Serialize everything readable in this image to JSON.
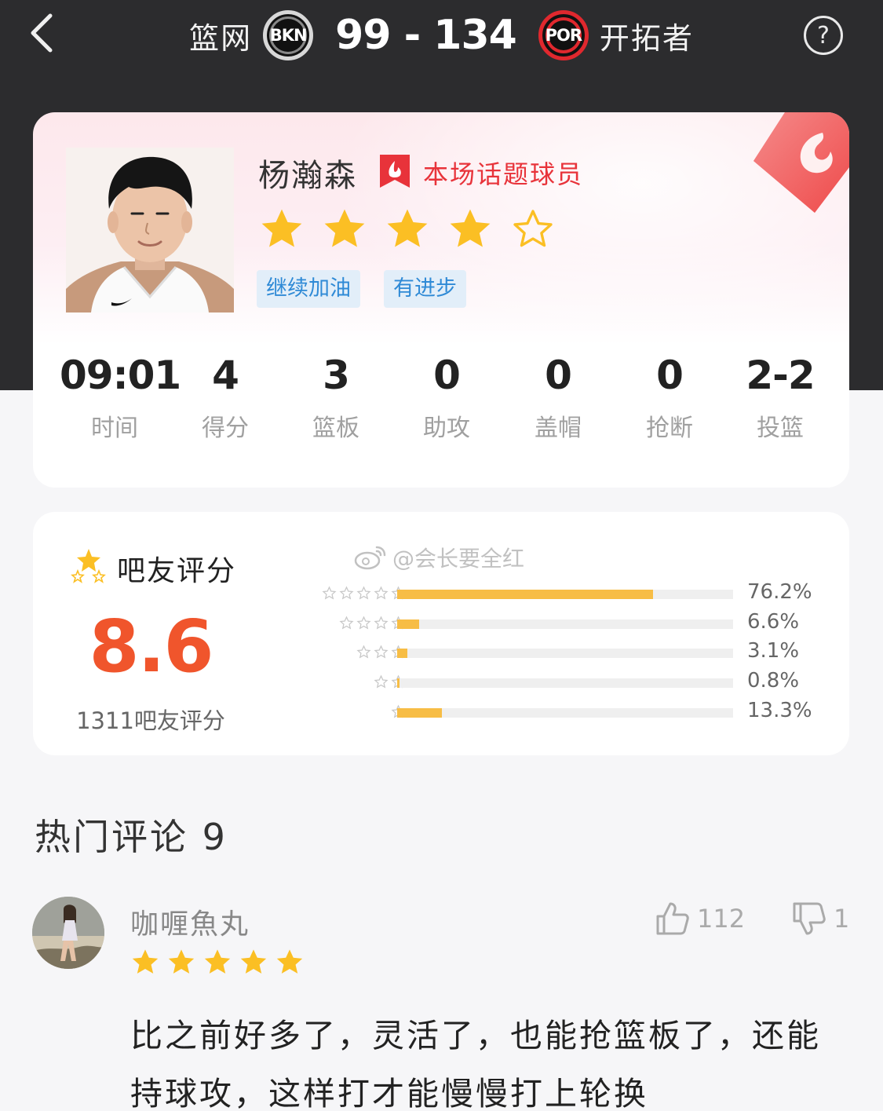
{
  "header": {
    "home_team": "篮网",
    "home_abbr": "BKN",
    "score": "99 - 134",
    "away_abbr": "POR",
    "away_team": "开拓者",
    "help_label": "?"
  },
  "player": {
    "name": "杨瀚森",
    "topic_label": "本场话题球员",
    "stars": 4,
    "max_stars": 5,
    "tags": [
      "继续加油",
      "有进步"
    ]
  },
  "stats": [
    {
      "value": "09:01",
      "label": "时间"
    },
    {
      "value": "4",
      "label": "得分"
    },
    {
      "value": "3",
      "label": "篮板"
    },
    {
      "value": "0",
      "label": "助攻"
    },
    {
      "value": "0",
      "label": "盖帽"
    },
    {
      "value": "0",
      "label": "抢断"
    },
    {
      "value": "2-2",
      "label": "投篮"
    }
  ],
  "rating": {
    "title": "吧友评分",
    "score": "8.6",
    "count_label": "1311吧友评分",
    "distribution": [
      {
        "stars": 5,
        "percent": 76.2,
        "label": "76.2%"
      },
      {
        "stars": 4,
        "percent": 6.6,
        "label": "6.6%"
      },
      {
        "stars": 3,
        "percent": 3.1,
        "label": "3.1%"
      },
      {
        "stars": 2,
        "percent": 0.8,
        "label": "0.8%"
      },
      {
        "stars": 1,
        "percent": 13.3,
        "label": "13.3%"
      }
    ]
  },
  "watermark": "@会长要全红",
  "comments_section": {
    "title": "热门评论 9"
  },
  "comment": {
    "author": "咖喱魚丸",
    "stars": 5,
    "likes": "112",
    "dislikes": "1",
    "text": "比之前好多了，灵活了，也能抢篮板了，还能持球攻，这样打才能慢慢打上轮换"
  },
  "colors": {
    "header_bg": "#2c2c2e",
    "star_gold": "#fbbf24",
    "accent_red": "#e8333a",
    "score_orange": "#f0552c",
    "tag_blue": "#2f8ad6",
    "bar_fill": "#f7bd45"
  }
}
